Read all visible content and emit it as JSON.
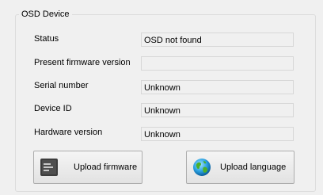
{
  "group": {
    "title": "OSD Device"
  },
  "fields": [
    {
      "label": "Status",
      "value": "OSD not found"
    },
    {
      "label": "Present firmware version",
      "value": ""
    },
    {
      "label": "Serial number",
      "value": "Unknown"
    },
    {
      "label": "Device ID",
      "value": "Unknown"
    },
    {
      "label": "Hardware version",
      "value": "Unknown"
    }
  ],
  "buttons": {
    "upload_firmware": {
      "label": "Upload firmware",
      "icon": "chip-icon"
    },
    "upload_language": {
      "label": "Upload language",
      "icon": "globe-icon"
    }
  }
}
